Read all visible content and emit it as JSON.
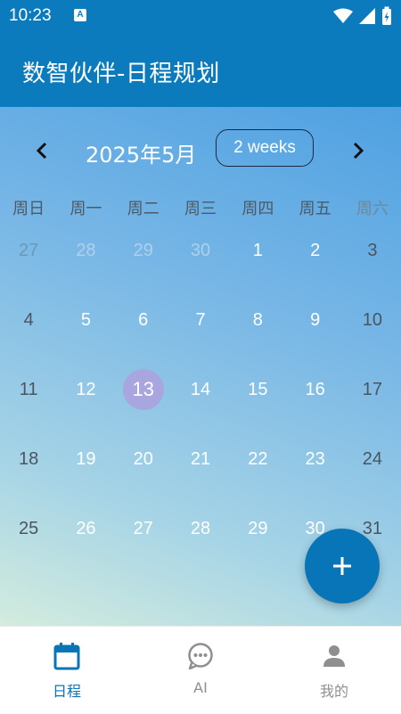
{
  "status_bar": {
    "time": "10:23",
    "notification_icon": "A"
  },
  "app": {
    "title": "数智伙伴-日程规划"
  },
  "calendar": {
    "month_label": "2025年5月",
    "range_toggle": "2 weeks",
    "weekdays": [
      "周日",
      "周一",
      "周二",
      "周三",
      "周四",
      "周五",
      "周六"
    ],
    "weeks": [
      [
        "27",
        "28",
        "29",
        "30",
        "1",
        "2",
        "3"
      ],
      [
        "4",
        "5",
        "6",
        "7",
        "8",
        "9",
        "10"
      ],
      [
        "11",
        "12",
        "13",
        "14",
        "15",
        "16",
        "17"
      ],
      [
        "18",
        "19",
        "20",
        "21",
        "22",
        "23",
        "24"
      ],
      [
        "25",
        "26",
        "27",
        "28",
        "29",
        "30",
        "31"
      ]
    ],
    "today": "13"
  },
  "bottom_nav": {
    "items": [
      {
        "label": "日程",
        "icon": "calendar-icon",
        "active": true
      },
      {
        "label": "AI",
        "icon": "chat-icon",
        "active": false
      },
      {
        "label": "我的",
        "icon": "person-icon",
        "active": false
      }
    ]
  },
  "colors": {
    "primary": "#0b7bbd",
    "today_highlight": "#a9a6df",
    "active_nav": "#0a75b6",
    "inactive_nav": "#8f8f8f"
  }
}
